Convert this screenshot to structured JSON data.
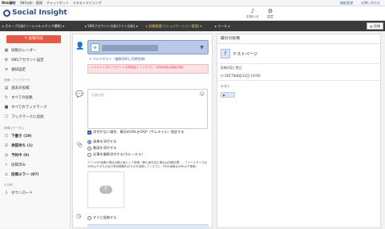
{
  "topbar": {
    "left": [
      "Web解析",
      "SNS分析・管理",
      "チャットボット",
      "テキストマイニング"
    ],
    "right": [
      "機能要望",
      "お問い合わせ"
    ]
  },
  "header": {
    "logo": "Social Insight",
    "notices_label": "お知らせ",
    "settings_label": "設定"
  },
  "navbar": {
    "items": [
      "グループ分析(ソーシャルメディア横断)",
      "SNSアカウント分析(ファン分析)",
      "投稿管理(コミュニケーション管理)",
      "ツール"
    ],
    "end_label": "投稿"
  },
  "sidebar": {
    "create_label": "投稿作成",
    "top_items": [
      {
        "icon": "calendar-icon",
        "glyph": "▦",
        "label": "投稿カレンダー"
      },
      {
        "icon": "gear-icon",
        "glyph": "⚙",
        "label": "SNSアカウント設定"
      },
      {
        "icon": "history-icon",
        "glyph": "≡",
        "label": "通知設定"
      }
    ],
    "section1": "投稿・ブックマーク",
    "mid_items": [
      {
        "icon": "past-posts-icon",
        "glyph": "▤",
        "label": "過去の投稿"
      },
      {
        "icon": "all-posts-icon",
        "glyph": "↻",
        "label": "すべての投稿"
      },
      {
        "icon": "bookmark-icon",
        "glyph": "■",
        "label": "すべてのブックマーク"
      },
      {
        "icon": "bookmark-outline-icon",
        "glyph": "☐",
        "label": "ブックマークに追加"
      }
    ],
    "section2": "投稿ステータス",
    "status_items": [
      {
        "icon": "draft-icon",
        "glyph": "☐",
        "label": "下書き (19)"
      },
      {
        "icon": "approval-icon",
        "glyph": "☑",
        "label": "承認待ち (1)"
      },
      {
        "icon": "scheduled-icon",
        "glyph": "◷",
        "label": "予約中 (0)"
      },
      {
        "icon": "posted-icon",
        "glyph": "✓",
        "label": "投稿済み"
      },
      {
        "icon": "error-icon",
        "glyph": "⚠",
        "label": "投稿エラー (87)"
      }
    ],
    "section3": "その他",
    "other_items": [
      {
        "icon": "download-icon",
        "glyph": "⇩",
        "label": "ダウンロード"
      }
    ]
  },
  "composer": {
    "multipost_link": "+ マルチポスト（複数SNSに同時投稿）",
    "warning_text": "ハイライトがたアカウントを再認証してください（有効化後は認証可能）",
    "post_placeholder": "投稿内容",
    "ogp_checkbox_label": "添付がない場合、最初のURLをOGP（サムネイル）指定する",
    "attach_options": [
      "画像を添付する",
      "動画を添付する",
      "記事を複数添付する(カルーセル)"
    ],
    "attach_selected": 0,
    "attach_note": "アニメGIF画像の場合は静止画として投稿（静止画を含む場合は自動処理）。ファイルサイズは5MB以下のもの及び有効期限内のものを投稿してください（PNG画像は5MB以下推奨）",
    "schedule_option": "すぐに投稿する"
  },
  "preview": {
    "header": "最近の投稿",
    "account_name": "テストページ",
    "status_label": "投稿内容と数日",
    "date": "2017年8月12日 14:00",
    "text": "テスト"
  }
}
